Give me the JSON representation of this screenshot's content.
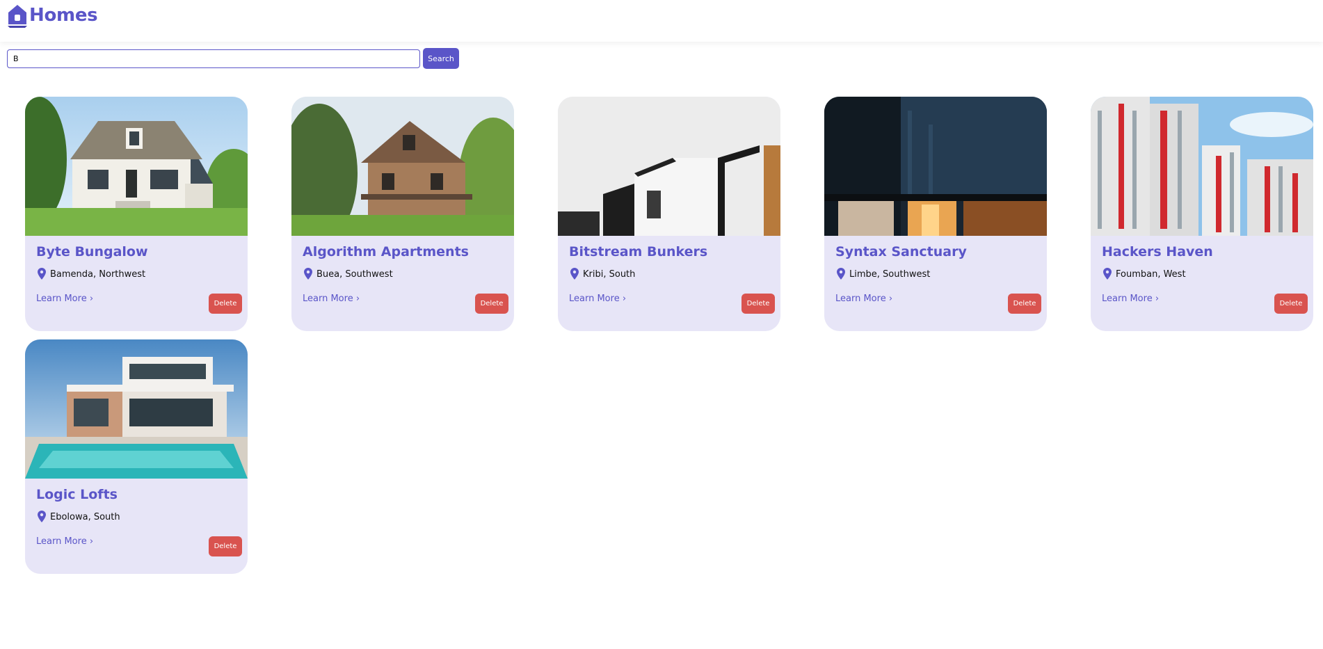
{
  "header": {
    "title": "Homes",
    "logo_icon": "house-icon",
    "accent": "#5a55c8"
  },
  "search": {
    "value": "B",
    "button_label": "Search"
  },
  "cards": [
    {
      "title": "Byte Bungalow",
      "location": "Bamenda, Northwest",
      "learn_more": "Learn More ›",
      "delete_label": "Delete",
      "image": "cottage-house-photo"
    },
    {
      "title": "Algorithm Apartments",
      "location": "Buea, Southwest",
      "learn_more": "Learn More ›",
      "delete_label": "Delete",
      "image": "victorian-house-photo"
    },
    {
      "title": "Bitstream Bunkers",
      "location": "Kribi, South",
      "learn_more": "Learn More ›",
      "delete_label": "Delete",
      "image": "modern-white-black-house-photo"
    },
    {
      "title": "Syntax Sanctuary",
      "location": "Limbe, Southwest",
      "learn_more": "Learn More ›",
      "delete_label": "Delete",
      "image": "dark-modern-facade-photo"
    },
    {
      "title": "Hackers Haven",
      "location": "Foumban, West",
      "learn_more": "Learn More ›",
      "delete_label": "Delete",
      "image": "apartment-towers-photo"
    },
    {
      "title": "Logic Lofts",
      "location": "Ebolowa, South",
      "learn_more": "Learn More ›",
      "delete_label": "Delete",
      "image": "villa-with-pool-photo"
    }
  ],
  "colors": {
    "accent": "#5a55c8",
    "card_bg": "#e7e5f7",
    "danger": "#d9534f"
  }
}
